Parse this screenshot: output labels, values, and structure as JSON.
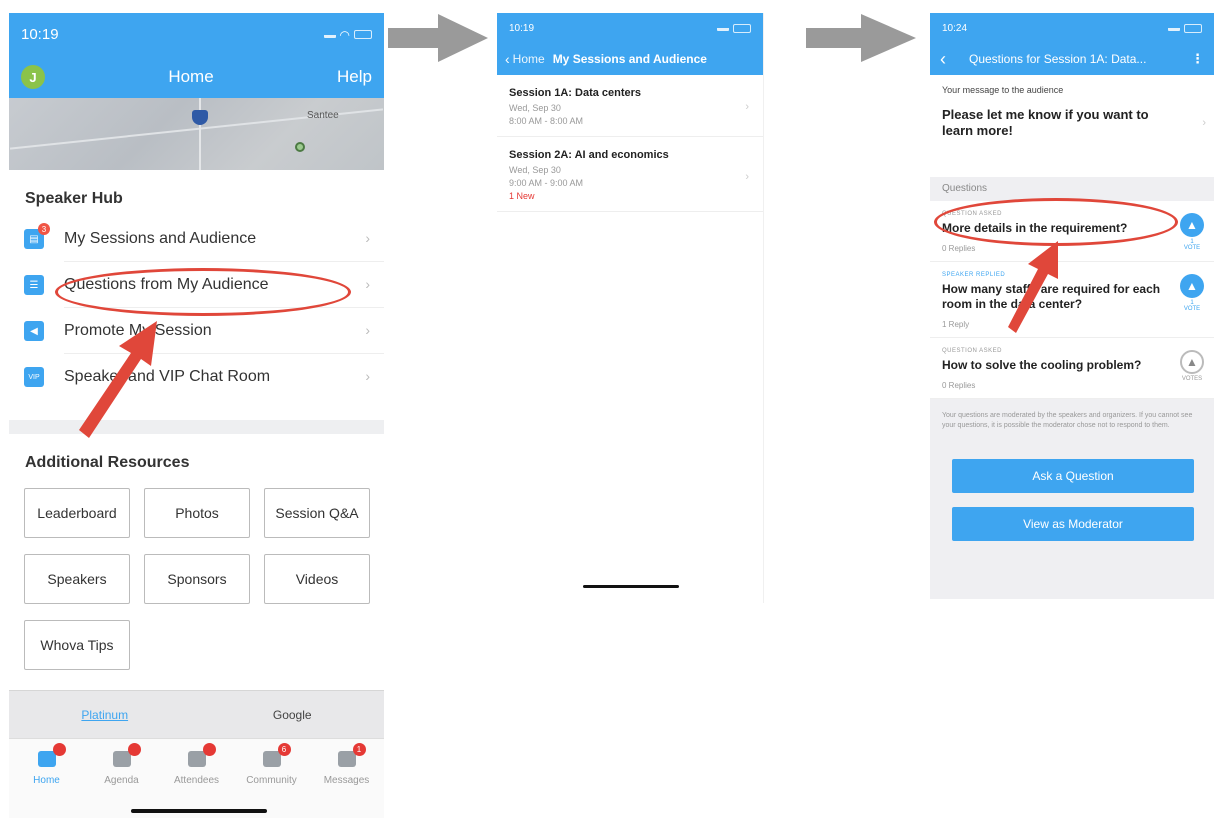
{
  "colors": {
    "brand_blue": "#3ea5f0",
    "annotation_red": "#e0473a",
    "flow_arrow_grey": "#9a9a9a"
  },
  "screen1": {
    "status_time": "10:19",
    "nav": {
      "avatar_initial": "J",
      "title": "Home",
      "help": "Help"
    },
    "map_label": "Santee",
    "speaker_hub_title": "Speaker Hub",
    "hub_items": [
      {
        "label": "My Sessions and Audience",
        "icon": "calendar-icon",
        "badge": "3"
      },
      {
        "label": "Questions from My Audience",
        "icon": "list-icon"
      },
      {
        "label": "Promote My Session",
        "icon": "megaphone-icon"
      },
      {
        "label": "Speaker and VIP Chat Room",
        "icon": "vip-icon"
      }
    ],
    "resources_title": "Additional Resources",
    "resources": [
      "Leaderboard",
      "Photos",
      "Session Q&A",
      "Speakers",
      "Sponsors",
      "Videos",
      "Whova Tips"
    ],
    "sponsors": {
      "link": "Platinum",
      "name": "Google"
    },
    "tabs": [
      {
        "label": "Home",
        "icon": "home-icon",
        "active": true
      },
      {
        "label": "Agenda",
        "icon": "agenda-icon"
      },
      {
        "label": "Attendees",
        "icon": "attendees-icon"
      },
      {
        "label": "Community",
        "icon": "community-icon",
        "badge": "6"
      },
      {
        "label": "Messages",
        "icon": "messages-icon",
        "badge": "1"
      }
    ]
  },
  "screen2": {
    "status_time": "10:19",
    "nav": {
      "back": "Home",
      "title": "My Sessions and Audience"
    },
    "sessions": [
      {
        "title": "Session 1A: Data centers",
        "date": "Wed, Sep 30",
        "time": "8:00 AM - 8:00 AM",
        "new": ""
      },
      {
        "title": "Session 2A: AI and economics",
        "date": "Wed, Sep 30",
        "time": "9:00 AM - 9:00 AM",
        "new": "1 New"
      }
    ]
  },
  "screen3": {
    "status_time": "10:24",
    "nav": {
      "title": "Questions for Session 1A: Data..."
    },
    "message_label": "Your message to the audience",
    "message_text": "Please let me know if you want to learn more!",
    "questions_header": "Questions",
    "questions": [
      {
        "tag": "Question asked",
        "text": "More details in the requirement?",
        "replies": "0 Replies",
        "votes": "1",
        "vote_label": "VOTE"
      },
      {
        "tag": "Speaker replied",
        "text": "How many staffs are required for each room in the data center?",
        "replies": "1 Reply",
        "votes": "1",
        "vote_label": "VOTE"
      },
      {
        "tag": "Question asked",
        "text": "How to solve the cooling problem?",
        "replies": "0 Replies",
        "votes": "",
        "vote_label": "VOTES"
      }
    ],
    "note": "Your questions are moderated by the speakers and organizers. If you cannot see your questions, it is possible the moderator chose not to respond to them.",
    "ask_button": "Ask a Question",
    "moderator_button": "View as Moderator"
  }
}
